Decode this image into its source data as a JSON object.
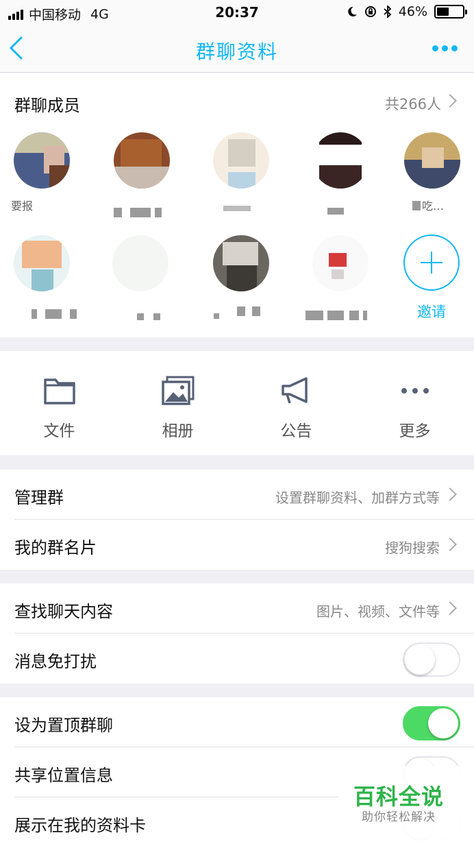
{
  "status_bar": {
    "carrier": "中国移动",
    "network": "4G",
    "time": "20:37",
    "battery_text": "46%",
    "battery_level": 0.46
  },
  "nav": {
    "title": "群聊资料"
  },
  "members": {
    "title": "群聊成员",
    "count": "共266人",
    "invite_label": "邀请",
    "visible_names": [
      "要报",
      "吃…"
    ]
  },
  "actions": [
    {
      "label": "文件",
      "icon": "folder-icon"
    },
    {
      "label": "相册",
      "icon": "photo-album-icon"
    },
    {
      "label": "公告",
      "icon": "megaphone-icon"
    },
    {
      "label": "更多",
      "icon": "more-dots-icon"
    }
  ],
  "settings": {
    "manage_group": {
      "label": "管理群",
      "value": "设置群聊资料、加群方式等"
    },
    "my_group_card": {
      "label": "我的群名片",
      "value": "搜狗搜索"
    },
    "search_chat": {
      "label": "查找聊天内容",
      "value": "图片、视频、文件等"
    },
    "do_not_disturb": {
      "label": "消息免打扰",
      "on": false
    },
    "pin_chat": {
      "label": "设为置顶群聊",
      "on": true
    },
    "share_location": {
      "label": "共享位置信息",
      "on": false
    },
    "show_on_card": {
      "label": "展示在我的资料卡",
      "on": false
    }
  },
  "colors": {
    "accent": "#12b7f5",
    "toggle_on": "#4cd964",
    "watermark": "#2fb44a"
  },
  "watermark": {
    "title": "百科全说",
    "subtitle": "助你轻松解决"
  }
}
